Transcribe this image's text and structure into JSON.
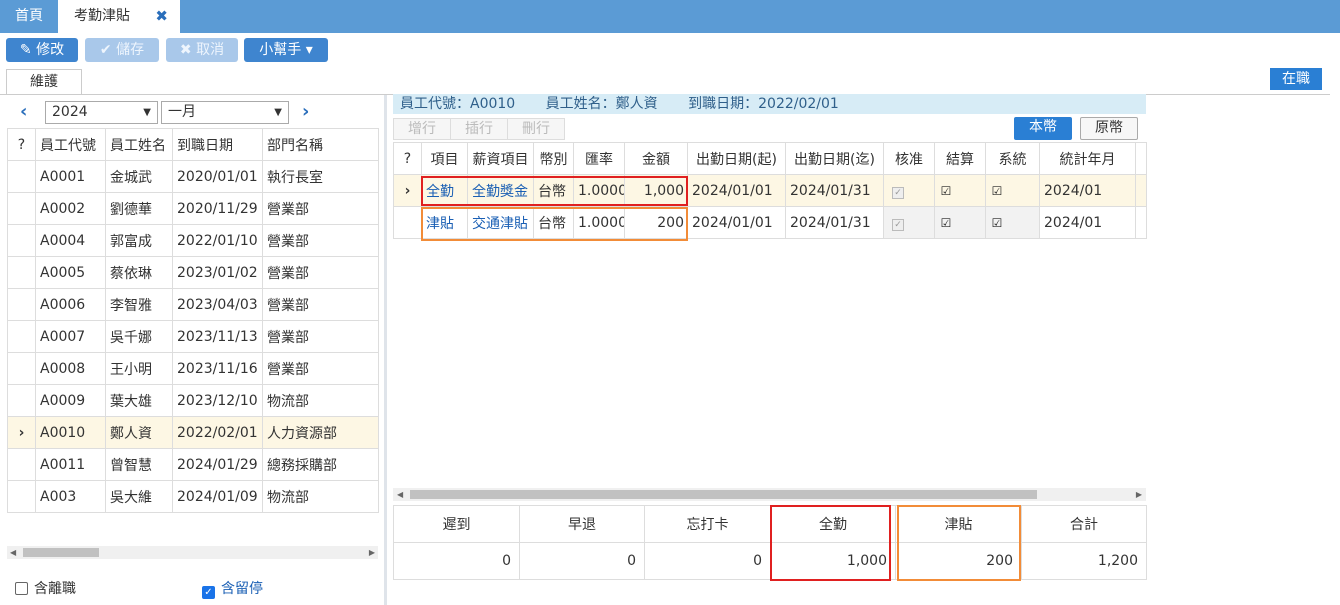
{
  "tabs": {
    "home": "首頁",
    "active": "考勤津貼",
    "close": "✖"
  },
  "toolbar": {
    "edit": "✎ 修改",
    "save": "✔ 儲存",
    "cancel": "✖ 取消",
    "helper": "小幫手 ▾"
  },
  "subtab": "維護",
  "status_badge": "在職",
  "filter": {
    "year": "2024",
    "month": "一月"
  },
  "employee_list": {
    "headers": [
      "員工代號",
      "員工姓名",
      "到職日期",
      "部門名稱"
    ],
    "rows": [
      [
        "A0001",
        "金城武",
        "2020/01/01",
        "執行長室"
      ],
      [
        "A0002",
        "劉德華",
        "2020/11/29",
        "營業部"
      ],
      [
        "A0004",
        "郭富成",
        "2022/01/10",
        "營業部"
      ],
      [
        "A0005",
        "蔡依琳",
        "2023/01/02",
        "營業部"
      ],
      [
        "A0006",
        "李智雅",
        "2023/04/03",
        "營業部"
      ],
      [
        "A0007",
        "吳千娜",
        "2023/11/13",
        "營業部"
      ],
      [
        "A0008",
        "王小明",
        "2023/11/16",
        "營業部"
      ],
      [
        "A0009",
        "葉大雄",
        "2023/12/10",
        "物流部"
      ],
      [
        "A0010",
        "鄭人資",
        "2022/02/01",
        "人力資源部"
      ],
      [
        "A0011",
        "曾智慧",
        "2024/01/29",
        "總務採購部"
      ],
      [
        "A003",
        "吳大維",
        "2024/01/09",
        "物流部"
      ]
    ],
    "selected_index": 8
  },
  "options": {
    "include_resigned": "含離職",
    "include_suspended": "含留停"
  },
  "employee_info": {
    "id": "員工代號：A0010",
    "name": "員工姓名：鄭人資",
    "hire_date": "到職日期：2022/02/01"
  },
  "row_buttons": [
    "增行",
    "插行",
    "刪行"
  ],
  "currency_buttons": {
    "local": "本幣",
    "original": "原幣"
  },
  "detail": {
    "headers": [
      "項目",
      "薪資項目",
      "幣別",
      "匯率",
      "金額",
      "出勤日期(起)",
      "出勤日期(迄)",
      "核准",
      "結算",
      "系統",
      "統計年月"
    ],
    "rows": [
      {
        "item": "全勤",
        "salary_item": "全勤獎金",
        "currency": "台幣",
        "rate": "1.0000",
        "amount": "1,000",
        "start": "2024/01/01",
        "end": "2024/01/31",
        "approved": false,
        "settled": true,
        "system": true,
        "period": "2024/01"
      },
      {
        "item": "津貼",
        "salary_item": "交通津貼",
        "currency": "台幣",
        "rate": "1.0000",
        "amount": "200",
        "start": "2024/01/01",
        "end": "2024/01/31",
        "approved": false,
        "settled": true,
        "system": true,
        "period": "2024/01"
      }
    ]
  },
  "summary": {
    "headers": [
      "遲到",
      "早退",
      "忘打卡",
      "全勤",
      "津貼",
      "合計"
    ],
    "values": [
      "0",
      "0",
      "0",
      "1,000",
      "200",
      "1,200"
    ]
  },
  "colors": {
    "topbar": "#5b9bd5",
    "primary": "#3f85cf",
    "highlight_red": "#e02020",
    "highlight_orange": "#f28c38"
  }
}
